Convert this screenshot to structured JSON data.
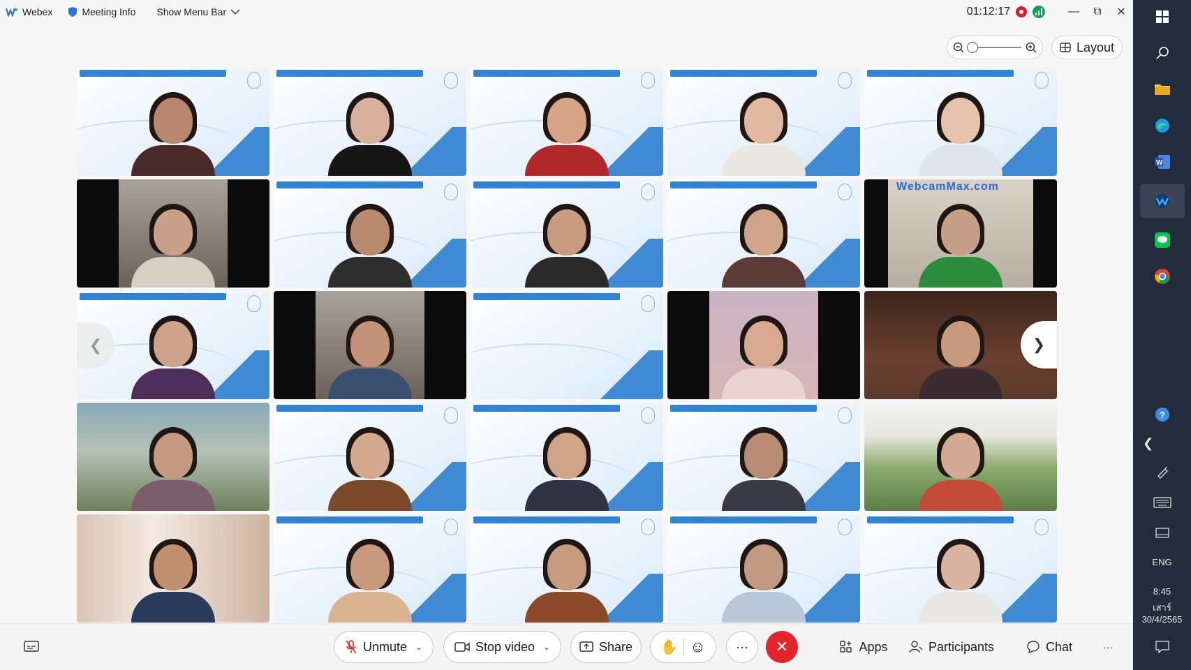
{
  "topbar": {
    "app_name": "Webex",
    "meeting_info": "Meeting Info",
    "show_menu_bar": "Show Menu Bar",
    "clock": "01:12:17"
  },
  "layout_btn": "Layout",
  "controls": {
    "unmute": "Unmute",
    "stop_video": "Stop video",
    "share": "Share",
    "more": "···",
    "apps": "Apps",
    "participants": "Participants",
    "chat": "Chat",
    "overflow": "···"
  },
  "tiles": [
    {
      "style": "bg"
    },
    {
      "style": "bg"
    },
    {
      "style": "bg"
    },
    {
      "style": "bg"
    },
    {
      "style": "bg"
    },
    {
      "style": "dark"
    },
    {
      "style": "bg"
    },
    {
      "style": "bg"
    },
    {
      "style": "bg"
    },
    {
      "style": "webcam",
      "watermark": "WebcamMax.com"
    },
    {
      "style": "bg"
    },
    {
      "style": "dark"
    },
    {
      "style": "bg-empty"
    },
    {
      "style": "blurpink"
    },
    {
      "style": "room"
    },
    {
      "style": "nature"
    },
    {
      "style": "bg"
    },
    {
      "style": "bg"
    },
    {
      "style": "bg"
    },
    {
      "style": "forest"
    },
    {
      "style": "curtain"
    },
    {
      "style": "bg"
    },
    {
      "style": "bg"
    },
    {
      "style": "bg"
    },
    {
      "style": "bg"
    }
  ],
  "system": {
    "lang": "ENG",
    "time": "8:45",
    "day": "เสาร์",
    "date": "30/4/2565"
  },
  "colors": {
    "accent": "#2f84d6",
    "end_call": "#e0252b",
    "taskbar": "#232c3a"
  }
}
